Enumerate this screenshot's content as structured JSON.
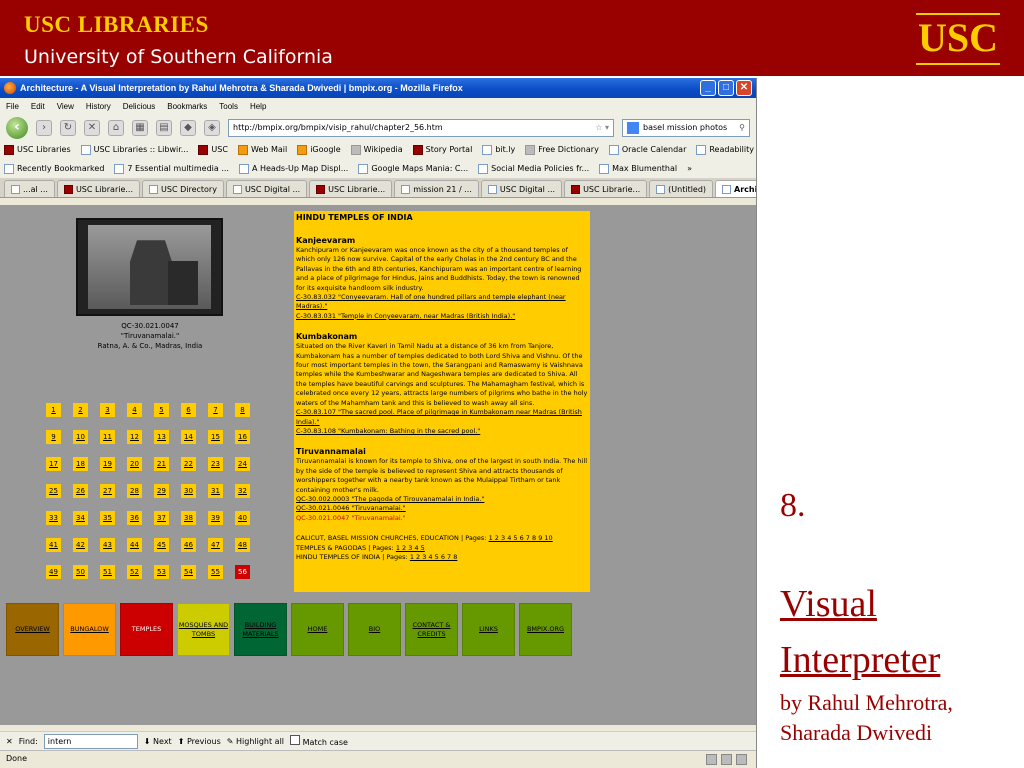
{
  "slide": {
    "header_line1": "USC LIBRARIES",
    "header_line2": "University of Southern California",
    "logo": "USC",
    "slide_number": "8.",
    "title_line1": "Visual",
    "title_line2": "Interpreter",
    "byline1": "by Rahul Mehrotra,",
    "byline2": "Sharada Dwivedi"
  },
  "browser": {
    "window_title": "Architecture - A Visual Interpretation by Rahul Mehrotra & Sharada Dwivedi | bmpix.org - Mozilla Firefox",
    "menu": [
      "File",
      "Edit",
      "View",
      "History",
      "Delicious",
      "Bookmarks",
      "Tools",
      "Help"
    ],
    "url": "http://bmpix.org/bmpix/visip_rahul/chapter2_56.htm",
    "search_value": "basel mission photos",
    "bookmarks": [
      "USC Libraries",
      "USC Libraries :: Libwir...",
      "USC",
      "Web Mail",
      "iGoogle",
      "Wikipedia",
      "Story Portal",
      "bit.ly",
      "Free Dictionary",
      "Oracle Calendar",
      "Readability",
      "OTIS"
    ],
    "bookmarks2": [
      "Recently Bookmarked",
      "7 Essential multimedia ...",
      "A Heads-Up Map Displ...",
      "Google Maps Mania: C...",
      "Social Media Policies fr...",
      "Max Blumenthal"
    ],
    "tabs": [
      "...al ...",
      "USC Librarie...",
      "USC Directory",
      "USC Digital ...",
      "USC Librarie...",
      "mission 21 / ...",
      "USC Digital ...",
      "USC Librarie...",
      "(Untitled)",
      "Archit..."
    ],
    "find_label": "Find:",
    "find_value": "intern",
    "find_next": "Next",
    "find_prev": "Previous",
    "highlight_all": "Highlight all",
    "match_case": "Match case",
    "status": "Done"
  },
  "page": {
    "photo_caption1": "QC-30.021.0047",
    "photo_caption2": "\"Tiruvanamalai.\"",
    "photo_caption3": "Ratna, A. & Co., Madras, India",
    "pages": [
      "1",
      "2",
      "3",
      "4",
      "5",
      "6",
      "7",
      "8",
      "9",
      "10",
      "11",
      "12",
      "13",
      "14",
      "15",
      "16",
      "17",
      "18",
      "19",
      "20",
      "21",
      "22",
      "23",
      "24",
      "25",
      "26",
      "27",
      "28",
      "29",
      "30",
      "31",
      "32",
      "33",
      "34",
      "35",
      "36",
      "37",
      "38",
      "39",
      "40",
      "41",
      "42",
      "43",
      "44",
      "45",
      "46",
      "47",
      "48",
      "49",
      "50",
      "51",
      "52",
      "53",
      "54",
      "55",
      "56"
    ],
    "current_page": "56",
    "heading": "HINDU TEMPLES OF INDIA",
    "s1_title": "Kanjeevaram",
    "s1_text": "Kanchipuram or Kanjeevaram was once known as the city of a thousand temples of which only 126 now survive. Capital of the early Cholas in the 2nd century BC and the Pallavas in the 6th and 8th centuries, Kanchipuram was an important centre of learning and a place of pilgrimage for Hindus, Jains and Buddhists. Today, the town is renowned for its exquisite handloom silk industry.",
    "s1_link1": "C-30.83.032 \"Conyeevaram. Hall of one hundred pillars and temple elephant (near Madras).\"",
    "s1_link2": "C-30.83.031 \"Temple in Conyeevaram, near Madras (British India).\"",
    "s2_title": "Kumbakonam",
    "s2_text": "Situated on the River Kaveri in Tamil Nadu at a distance of 36 km from Tanjore, Kumbakonam has a number of temples dedicated to both Lord Shiva and Vishnu. Of the four most important temples in the town, the Sarangpani and Ramaswamy is Vaishnava temples while the Kumbeshwarar and Nageshwara temples are dedicated to Shiva. All the temples have beautiful carvings and sculptures. The Mahamagham festival, which is celebrated once every 12 years, attracts large numbers of pilgrims who bathe in the holy waters of the Mahamham tank and this is believed to wash away all sins.",
    "s2_link1": "C-30.83.107 \"The sacred pool. Place of pilgrimage in Kumbakonam near Madras (British India).\"",
    "s2_link2": "C-30.83.108 \"Kumbakonam: Bathing in the sacred pool.\"",
    "s3_title": "Tiruvannamalai",
    "s3_text": "Tiruvannamalai is known for its temple to Shiva, one of the largest in south India. The hill by the side of the temple is believed to represent Shiva and attracts thousands of worshippers together with a nearby tank known as the Mulaippal Tirtham or tank containing mother's milk.",
    "s3_link1": "QC-30.002.0003 \"The pagoda of Tirouvanamalai in India.\"",
    "s3_link2": "QC-30.021.0046 \"Tiruvanamalai.\"",
    "s3_current": "QC-30.021.0047 \"Tiruvanamalai.\"",
    "pl1_label": "CALICUT, BASEL MISSION CHURCHES, EDUCATION | Pages:",
    "pl1_pages": "1 2 3 4 5 6 7 8 9 10",
    "pl2_label": "TEMPLES & PAGODAS | Pages:",
    "pl2_pages": "1 2 3 4 5",
    "pl3_label": "HINDU TEMPLES OF INDIA | Pages:",
    "pl3_pages": "1 2 3 4 5 6 7 8",
    "nav": [
      {
        "label": "OVERVIEW",
        "color": "#996600",
        "w": 53
      },
      {
        "label": "BUNGALOW",
        "color": "#FF9900",
        "w": 53
      },
      {
        "label": "TEMPLES",
        "color": "#CC0000",
        "w": 53,
        "current": true
      },
      {
        "label": "MOSQUES AND TOMBS",
        "color": "#CCCC00",
        "w": 53
      },
      {
        "label": "BUILDING MATERIALS",
        "color": "#006633",
        "w": 53
      },
      {
        "label": "HOME",
        "color": "#669900",
        "w": 53
      },
      {
        "label": "BIO",
        "color": "#669900",
        "w": 53
      },
      {
        "label": "CONTACT & CREDITS",
        "color": "#669900",
        "w": 53
      },
      {
        "label": "LINKS",
        "color": "#669900",
        "w": 53
      },
      {
        "label": "BMPIX.ORG",
        "color": "#669900",
        "w": 53
      }
    ]
  }
}
